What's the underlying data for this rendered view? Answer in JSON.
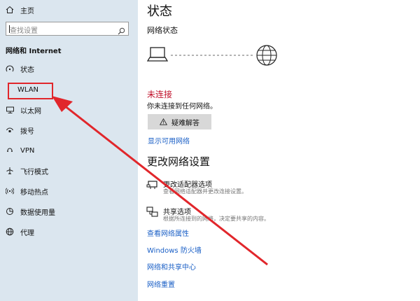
{
  "sidebar": {
    "home_label": "主页",
    "search_placeholder": "查找设置",
    "section_title": "网络和 Internet",
    "items": [
      {
        "label": "状态"
      },
      {
        "label": "WLAN"
      },
      {
        "label": "以太网"
      },
      {
        "label": "拨号"
      },
      {
        "label": "VPN"
      },
      {
        "label": "飞行模式"
      },
      {
        "label": "移动热点"
      },
      {
        "label": "数据使用量"
      },
      {
        "label": "代理"
      }
    ]
  },
  "main": {
    "page_title": "状态",
    "network_status_title": "网络状态",
    "status_text": "未连接",
    "status_desc": "你未连接到任何网络。",
    "troubleshoot_label": "疑难解答",
    "show_networks_link": "显示可用网络",
    "change_settings_title": "更改网络设置",
    "adapter": {
      "title": "更改适配器选项",
      "desc": "查看网络适配器并更改连接设置。"
    },
    "sharing": {
      "title": "共享选项",
      "desc": "根据所连接到的网络，决定要共享的内容。"
    },
    "links": [
      "查看网络属性",
      "Windows 防火墙",
      "网络和共享中心",
      "网络重置"
    ]
  },
  "colors": {
    "accent_red": "#c0102a",
    "link_blue": "#1a5fc6",
    "annotation_red": "#e1262b"
  }
}
